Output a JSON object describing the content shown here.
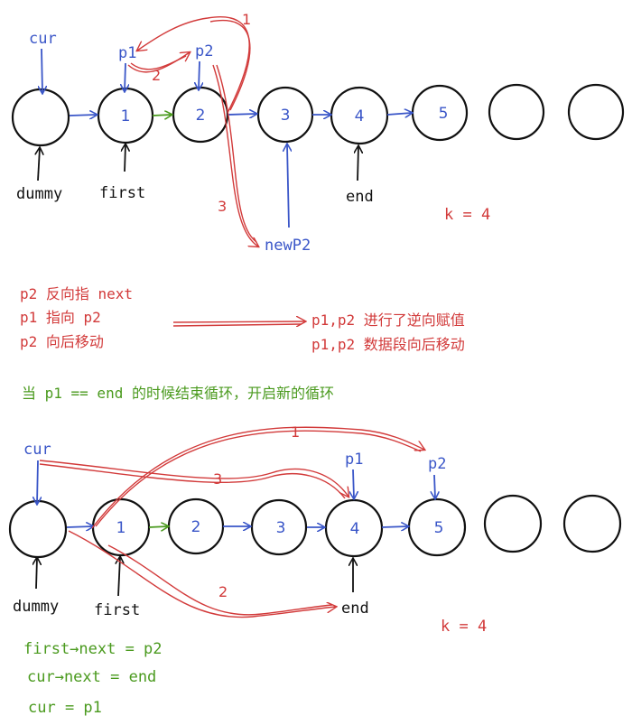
{
  "top": {
    "node_labels": [
      "1",
      "2",
      "3",
      "4",
      "5"
    ],
    "pointers": {
      "cur": "cur",
      "p1": "p1",
      "p2": "p2",
      "dummy": "dummy",
      "first": "first",
      "end": "end",
      "newP2": "newP2"
    },
    "step_labels": [
      "1",
      "2",
      "3"
    ],
    "k_label": "k = 4"
  },
  "notes": {
    "left_lines": [
      "p2 反向指 next",
      "p1 指向 p2",
      "p2 向后移动"
    ],
    "right_lines": [
      "p1,p2 进行了逆向赋值",
      "p1,p2 数据段向后移动"
    ],
    "loop_condition": "当 p1 == end 的时候结束循环，开启新的循环"
  },
  "bottom": {
    "node_labels": [
      "1",
      "2",
      "3",
      "4",
      "5"
    ],
    "pointers": {
      "cur": "cur",
      "p1": "p1",
      "p2": "p2",
      "dummy": "dummy",
      "first": "first",
      "end": "end"
    },
    "step_labels": [
      "1",
      "3",
      "2"
    ],
    "k_label": "k = 4",
    "code_lines": [
      "first→next = p2",
      "cur→next = end",
      "cur = p1"
    ]
  },
  "colors": {
    "blue": "#3a56c8",
    "red": "#d23a3a",
    "green": "#4a9a1e",
    "black": "#111111"
  }
}
